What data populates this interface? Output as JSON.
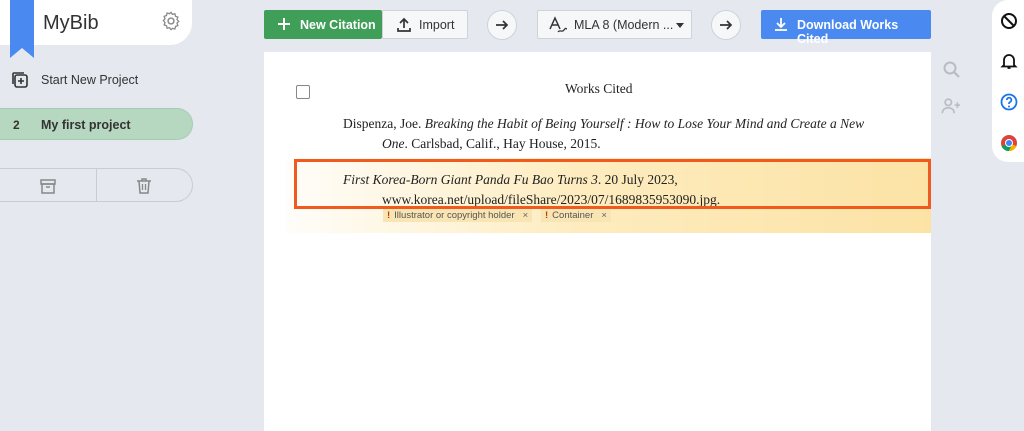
{
  "app": {
    "name": "MyBib"
  },
  "sidebar": {
    "new_project_label": "Start New Project",
    "projects": [
      {
        "number": "2",
        "name": "My first project"
      }
    ]
  },
  "toolbar": {
    "new_citation_label": "New Citation",
    "import_label": "Import",
    "citation_style": "MLA 8 (Modern ...",
    "download_label": "Download Works Cited"
  },
  "document": {
    "title": "Works Cited",
    "citations": [
      {
        "author": "Dispenza, Joe. ",
        "title_italic": "Breaking the Habit of Being Yourself : How to Lose Your Mind and Create a New",
        "title_italic_cont": "One",
        "rest": ". Carlsbad, Calif., Hay House, 2015."
      },
      {
        "title_italic": "First Korea-Born Giant Panda Fu Bao Turns 3",
        "date": ". 20 July 2023,",
        "url": "www.korea.net/upload/fileShare/2023/07/1689835953090.jpg."
      }
    ],
    "missing_fields": [
      {
        "mark": "!",
        "label": "Illustrator or copyright holder",
        "close": "×"
      },
      {
        "mark": "!",
        "label": "Container",
        "close": "×"
      }
    ]
  },
  "colors": {
    "primary_green": "#3f9e58",
    "primary_blue": "#4a8af0",
    "highlight_border": "#f15a1f"
  }
}
